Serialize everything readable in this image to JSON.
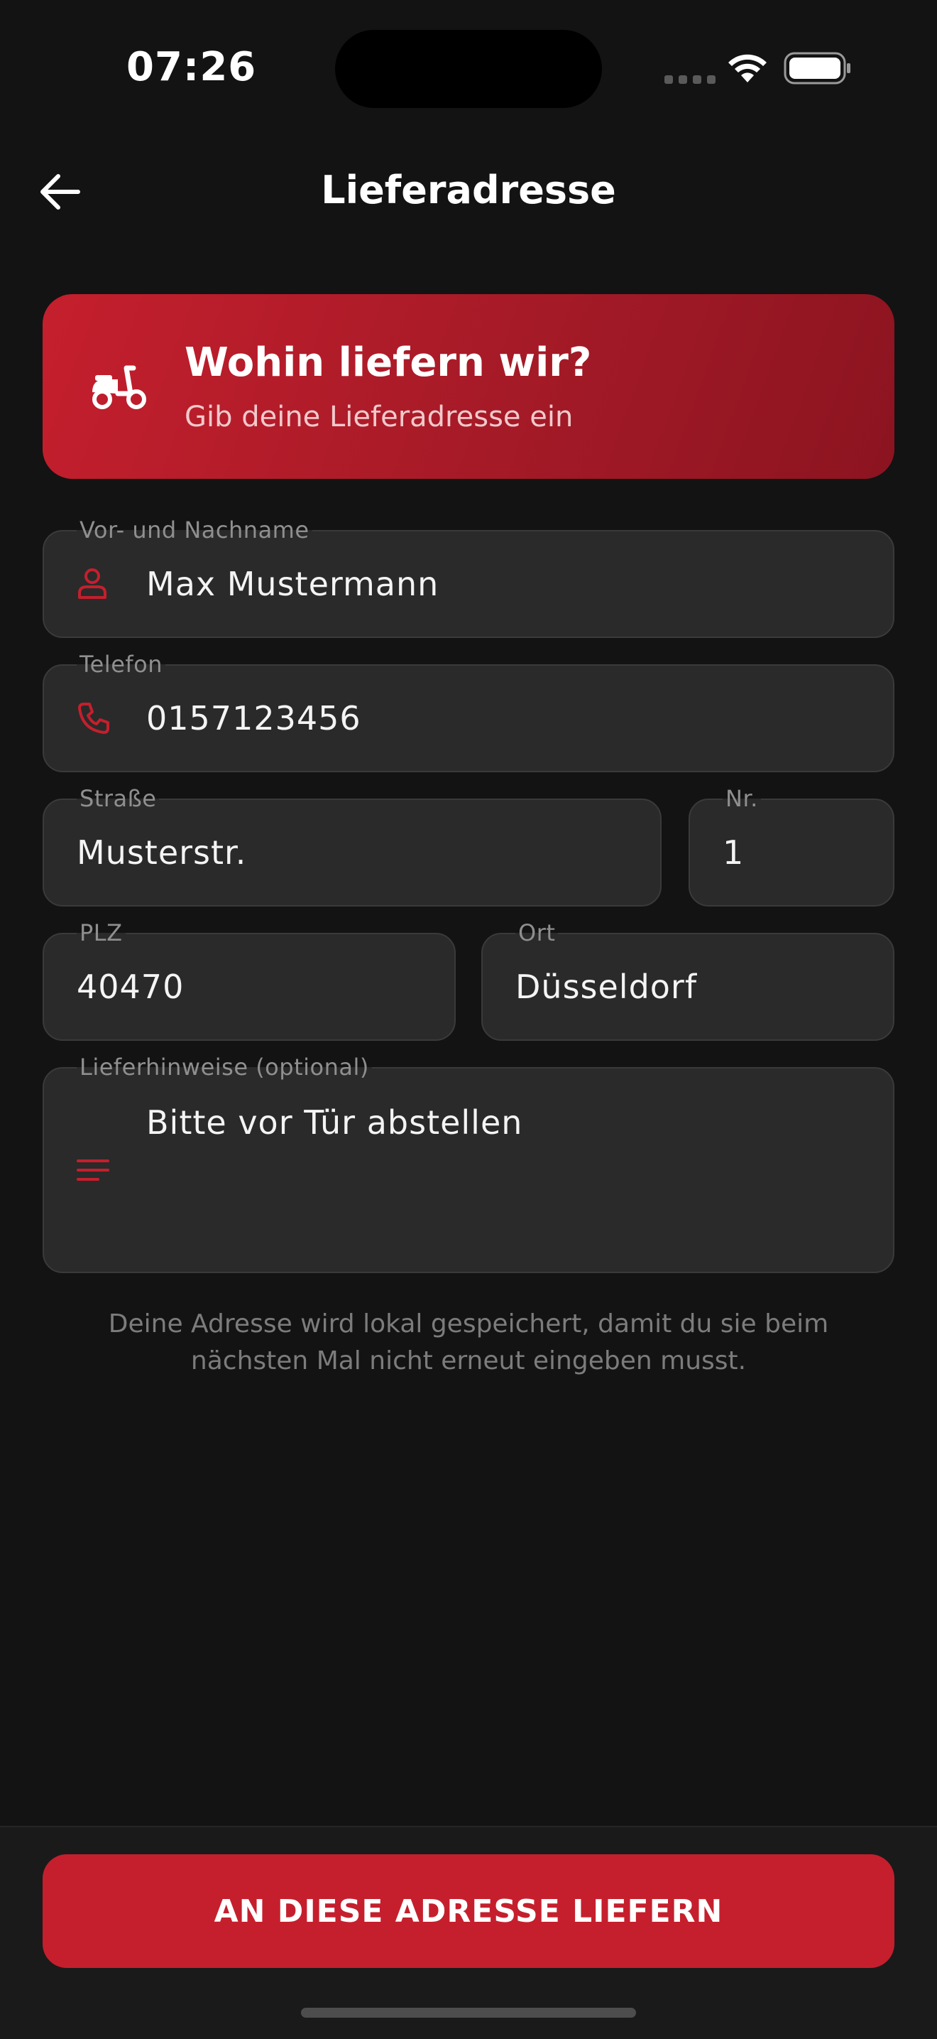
{
  "status": {
    "time": "07:26"
  },
  "header": {
    "title": "Lieferadresse"
  },
  "banner": {
    "title": "Wohin liefern wir?",
    "subtitle": "Gib deine Lieferadresse ein"
  },
  "form": {
    "name": {
      "label": "Vor- und Nachname",
      "value": "Max Mustermann"
    },
    "phone": {
      "label": "Telefon",
      "value": "0157123456"
    },
    "street": {
      "label": "Straße",
      "value": "Musterstr."
    },
    "number": {
      "label": "Nr.",
      "value": "1"
    },
    "zip": {
      "label": "PLZ",
      "value": "40470"
    },
    "city": {
      "label": "Ort",
      "value": "Düsseldorf"
    },
    "notes": {
      "label": "Lieferhinweise (optional)",
      "value": "Bitte vor Tür abstellen"
    }
  },
  "hint": "Deine Adresse wird lokal gespeichert, damit du sie beim nächsten Mal nicht erneut eingeben musst.",
  "cta": {
    "label": "AN DIESE ADRESSE LIEFERN"
  },
  "colors": {
    "accent": "#c51f2d",
    "background": "#131313",
    "field": "#2a2a2a"
  },
  "icons": [
    "back-arrow-icon",
    "scooter-icon",
    "person-icon",
    "phone-icon",
    "notes-icon",
    "wifi-icon",
    "battery-icon",
    "cellular-icon"
  ]
}
